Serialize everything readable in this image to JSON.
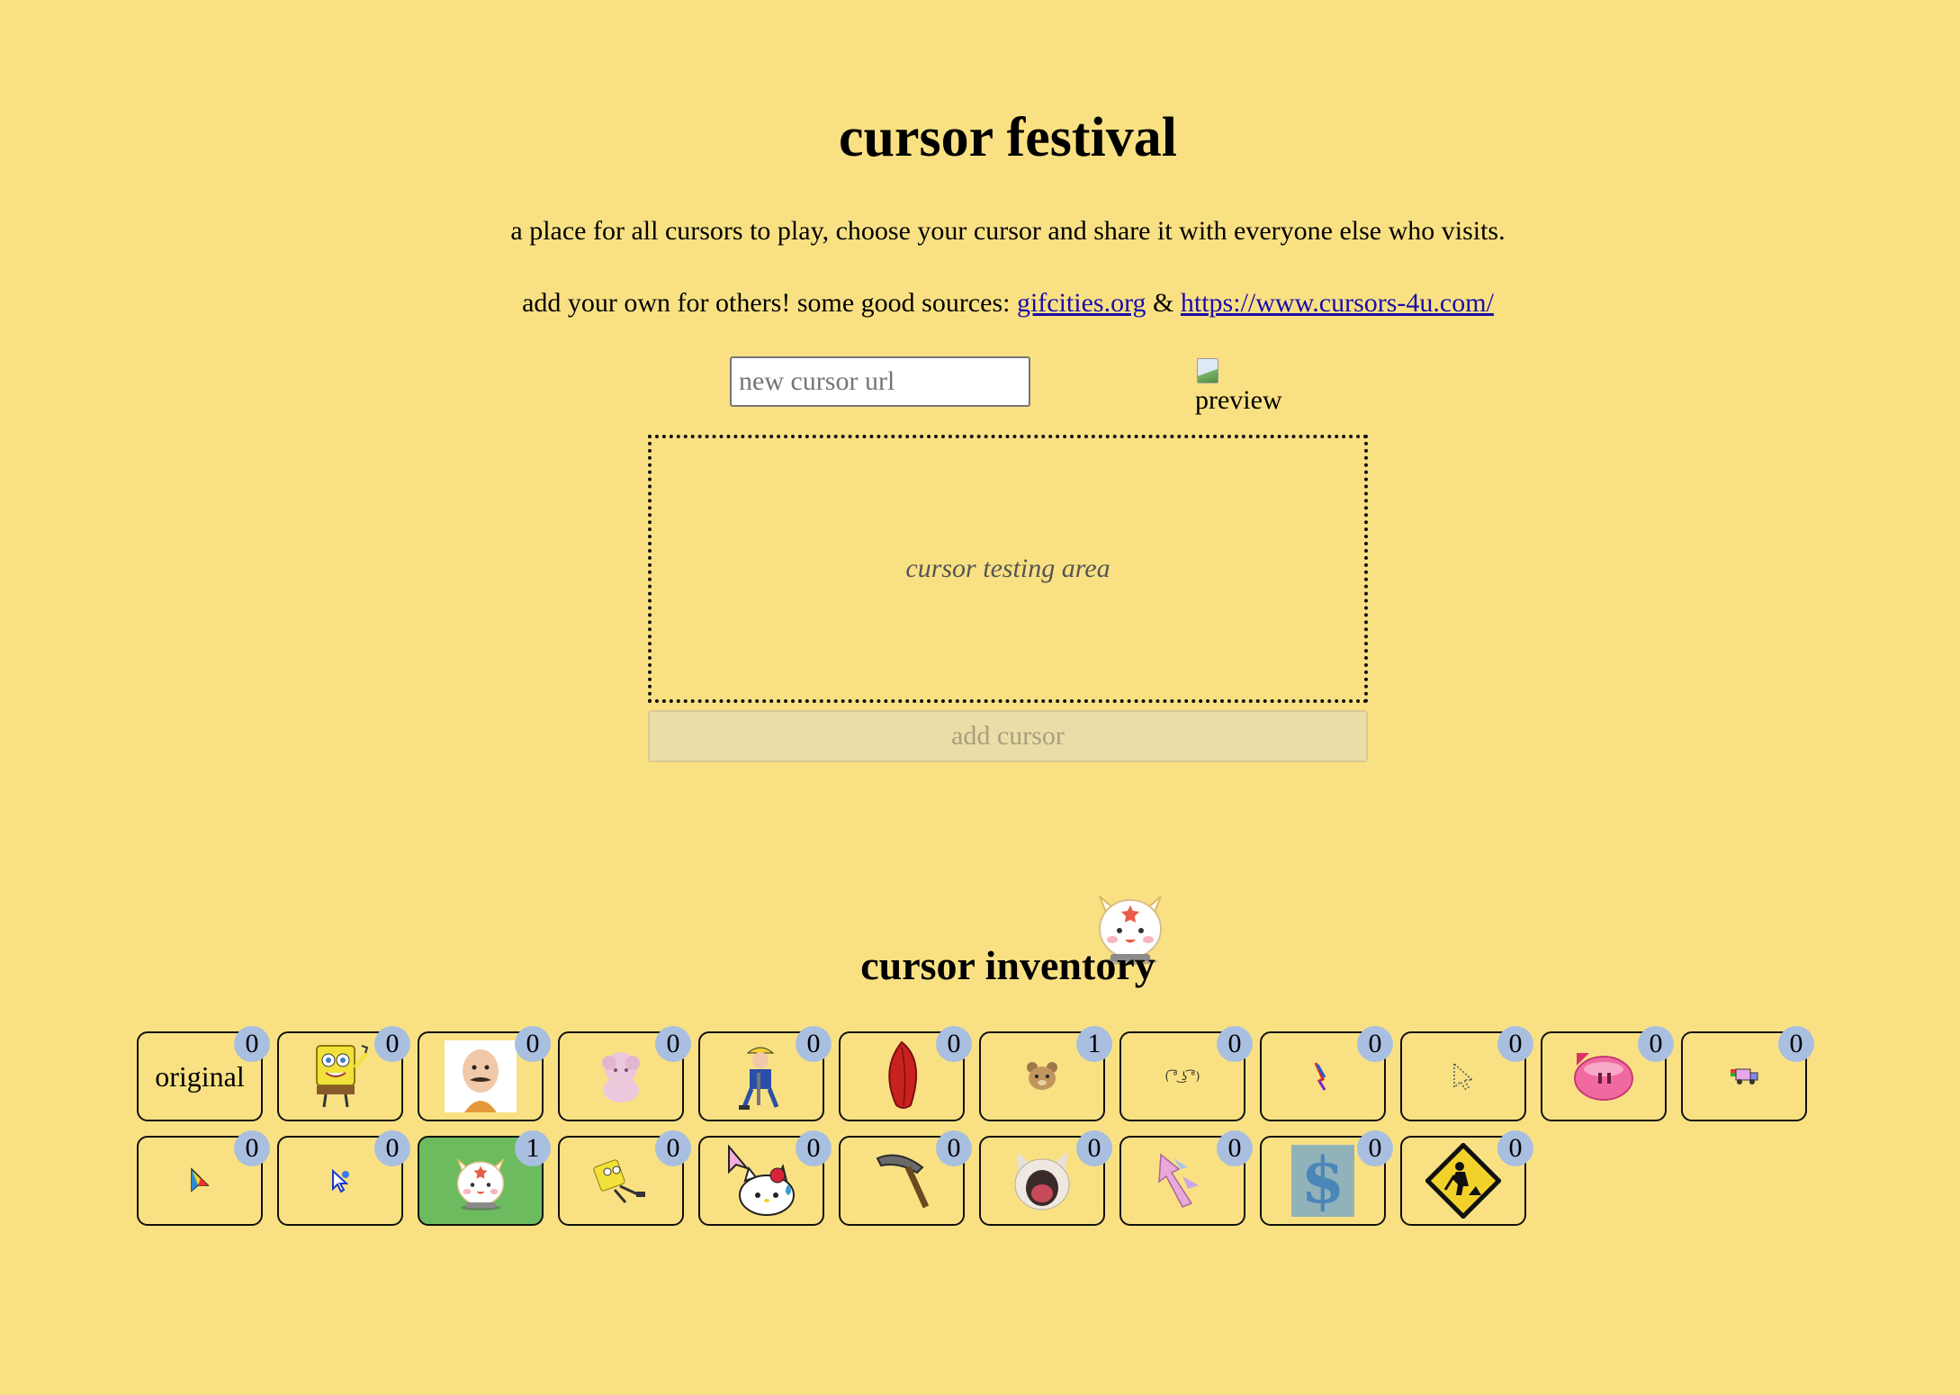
{
  "header": {
    "title": "cursor festival",
    "tagline": "a place for all cursors to play, choose your cursor and share it with everyone else who visits.",
    "sources_prefix": "add your own for others! some good sources: ",
    "source_link_1": "gifcities.org",
    "sources_and": " & ",
    "source_link_2": "https://www.cursors-4u.com/"
  },
  "form": {
    "url_placeholder": "new cursor url",
    "url_value": "",
    "preview_alt": "preview",
    "test_area_label": "cursor testing area",
    "add_button_label": "add cursor"
  },
  "inventory": {
    "heading": "cursor inventory",
    "items": [
      {
        "name": "original",
        "label": "original",
        "count": "0",
        "icon": "text-label",
        "selected": false
      },
      {
        "name": "spongebob",
        "label": "",
        "count": "0",
        "icon": "spongebob-icon",
        "selected": false
      },
      {
        "name": "bald-man",
        "label": "",
        "count": "0",
        "icon": "bald-man-icon",
        "selected": false
      },
      {
        "name": "pink-sheep",
        "label": "",
        "count": "0",
        "icon": "pink-sheep-icon",
        "selected": false
      },
      {
        "name": "construction-worker",
        "label": "",
        "count": "0",
        "icon": "construction-worker-icon",
        "selected": false
      },
      {
        "name": "red-feather",
        "label": "",
        "count": "0",
        "icon": "red-feather-icon",
        "selected": false
      },
      {
        "name": "teddy-bear",
        "label": "",
        "count": "1",
        "icon": "teddy-bear-icon",
        "selected": false
      },
      {
        "name": "kaomoji",
        "label": "",
        "count": "0",
        "icon": "kaomoji-icon",
        "selected": false
      },
      {
        "name": "rainbow-pointer",
        "label": "",
        "count": "0",
        "icon": "rainbow-pointer-icon",
        "selected": false
      },
      {
        "name": "dotted-arrow",
        "label": "",
        "count": "0",
        "icon": "dotted-arrow-icon",
        "selected": false
      },
      {
        "name": "pink-blob",
        "label": "",
        "count": "0",
        "icon": "pink-blob-icon",
        "selected": false
      },
      {
        "name": "nyan-truck",
        "label": "",
        "count": "0",
        "icon": "nyan-truck-icon",
        "selected": false
      },
      {
        "name": "color-arrow",
        "label": "",
        "count": "0",
        "icon": "color-arrow-icon",
        "selected": false
      },
      {
        "name": "blue-arrow",
        "label": "",
        "count": "0",
        "icon": "blue-arrow-icon",
        "selected": false
      },
      {
        "name": "bunny-angel",
        "label": "",
        "count": "1",
        "icon": "bunny-angel-icon",
        "selected": true
      },
      {
        "name": "spongebob-running",
        "label": "",
        "count": "0",
        "icon": "spongebob-running-icon",
        "selected": false
      },
      {
        "name": "hello-kitty",
        "label": "",
        "count": "0",
        "icon": "hello-kitty-icon",
        "selected": false
      },
      {
        "name": "pickaxe",
        "label": "",
        "count": "0",
        "icon": "pickaxe-icon",
        "selected": false
      },
      {
        "name": "screaming-cat",
        "label": "",
        "count": "0",
        "icon": "screaming-cat-icon",
        "selected": false
      },
      {
        "name": "pastel-arrow",
        "label": "",
        "count": "0",
        "icon": "pastel-arrow-icon",
        "selected": false
      },
      {
        "name": "blue-dollar",
        "label": "",
        "count": "0",
        "icon": "blue-dollar-icon",
        "selected": false
      },
      {
        "name": "construction-sign",
        "label": "",
        "count": "0",
        "icon": "construction-sign-icon",
        "selected": false
      }
    ]
  },
  "colors": {
    "background": "#f9e183",
    "count_badge": "#a9bfe0",
    "selected_tile": "#6cbb5e",
    "link": "#1a0dab"
  }
}
